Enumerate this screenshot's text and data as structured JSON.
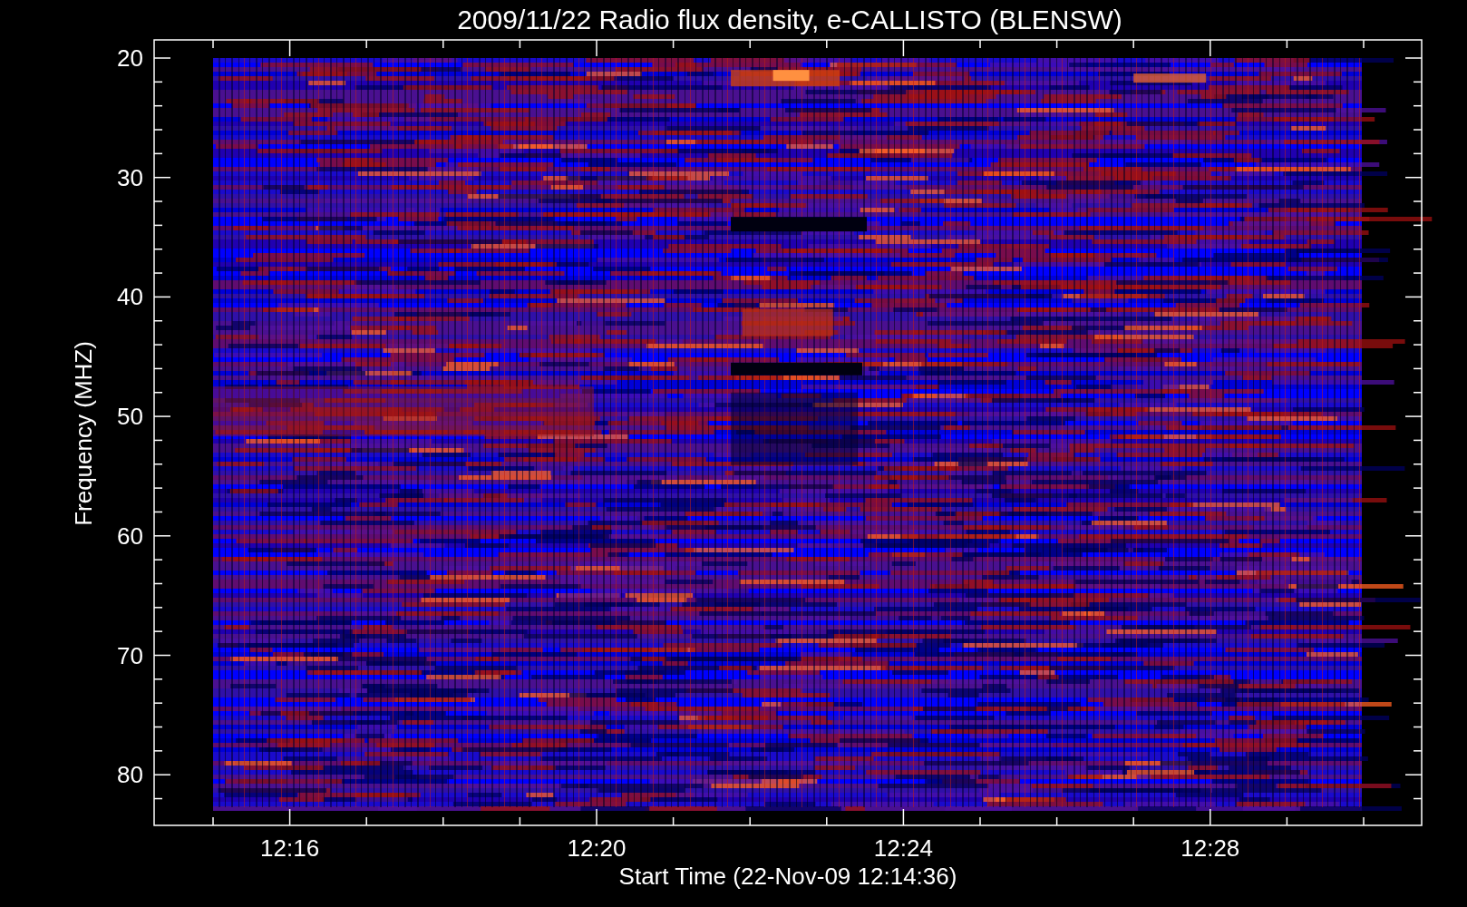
{
  "title": "2009/11/22  Radio flux density, e-CALLISTO (BLENSW)",
  "plot": {
    "y_axis": {
      "label": "Frequency (MHZ)",
      "ticks": [
        "20",
        "30",
        "40",
        "50",
        "60",
        "70",
        "80"
      ]
    },
    "x_axis": {
      "label": "Start Time (22-Nov-09 12:14:36)",
      "ticks": [
        "12:16",
        "12:20",
        "12:24",
        "12:28"
      ]
    }
  }
}
